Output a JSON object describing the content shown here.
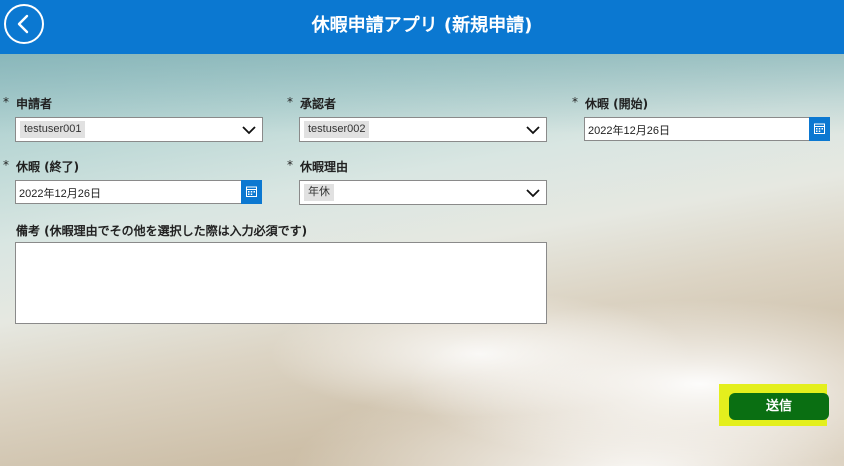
{
  "header": {
    "title": "休暇申請アプリ (新規申請)",
    "back_icon": "chevron-left-icon",
    "color": "#0b78d1"
  },
  "form": {
    "required_mark": "*",
    "applicant": {
      "label": "申請者",
      "value": "testuser001"
    },
    "approver": {
      "label": "承認者",
      "value": "testuser002"
    },
    "leave_start": {
      "label": "休暇 (開始)",
      "value": "2022年12月26日"
    },
    "leave_end": {
      "label": "休暇 (終了)",
      "value": "2022年12月26日"
    },
    "leave_reason": {
      "label": "休暇理由",
      "value": "年休"
    },
    "remarks": {
      "label": "備考 (休暇理由でその他を選択した際は入力必須です)",
      "value": ""
    }
  },
  "actions": {
    "submit_label": "送信",
    "submit_color": "#0a6f12",
    "highlight_color": "#e4ef1d"
  }
}
